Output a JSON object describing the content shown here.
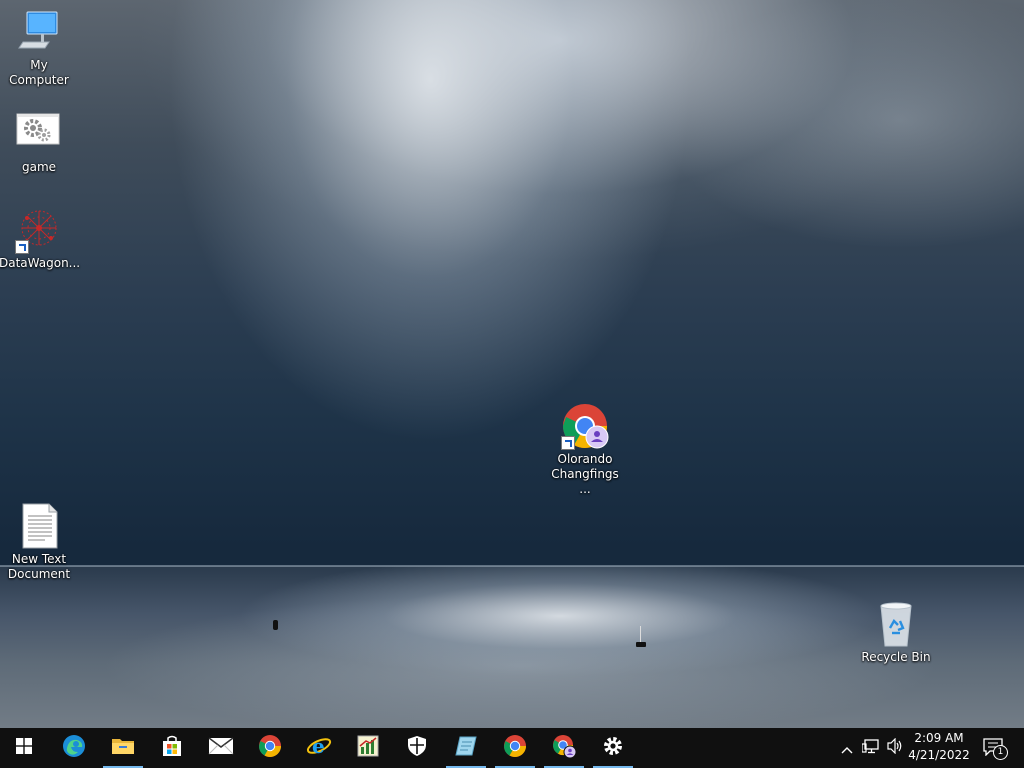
{
  "desktop": {
    "icons": [
      {
        "label": "My Computer",
        "icon": "computer-icon"
      },
      {
        "label": "game",
        "icon": "gears-icon"
      },
      {
        "label": "DataWagon...",
        "icon": "datawagon-icon"
      },
      {
        "label": "Olorando Changfings ...",
        "icon": "chrome-profile-icon"
      },
      {
        "label": "New Text Document",
        "icon": "text-document-icon"
      },
      {
        "label": "Recycle Bin",
        "icon": "recycle-bin-icon"
      }
    ]
  },
  "taskbar": {
    "buttons": [
      {
        "name": "start-button",
        "icon": "windows-logo-icon"
      },
      {
        "name": "edge",
        "icon": "edge-icon"
      },
      {
        "name": "file-explorer",
        "icon": "folder-icon"
      },
      {
        "name": "microsoft-store",
        "icon": "store-icon"
      },
      {
        "name": "mail",
        "icon": "mail-icon"
      },
      {
        "name": "chrome",
        "icon": "chrome-icon"
      },
      {
        "name": "internet-explorer",
        "icon": "ie-icon"
      },
      {
        "name": "spreadsheet-app",
        "icon": "chart-app-icon"
      },
      {
        "name": "windows-security",
        "icon": "shield-icon"
      },
      {
        "name": "notepad-like-app",
        "icon": "notepad-icon"
      },
      {
        "name": "chrome-2",
        "icon": "chrome-icon"
      },
      {
        "name": "chrome-profile",
        "icon": "chrome-profile-icon"
      },
      {
        "name": "settings",
        "icon": "gear-icon"
      }
    ],
    "tray": {
      "time": "2:09 AM",
      "date": "4/21/2022",
      "notification_count": "1"
    }
  },
  "colors": {
    "taskbar_bg": "#101010",
    "running_indicator": "#76b9ed",
    "chrome_red": "#db4437",
    "chrome_yellow": "#f4b400",
    "chrome_green": "#0f9d58",
    "chrome_blue": "#4285f4"
  }
}
